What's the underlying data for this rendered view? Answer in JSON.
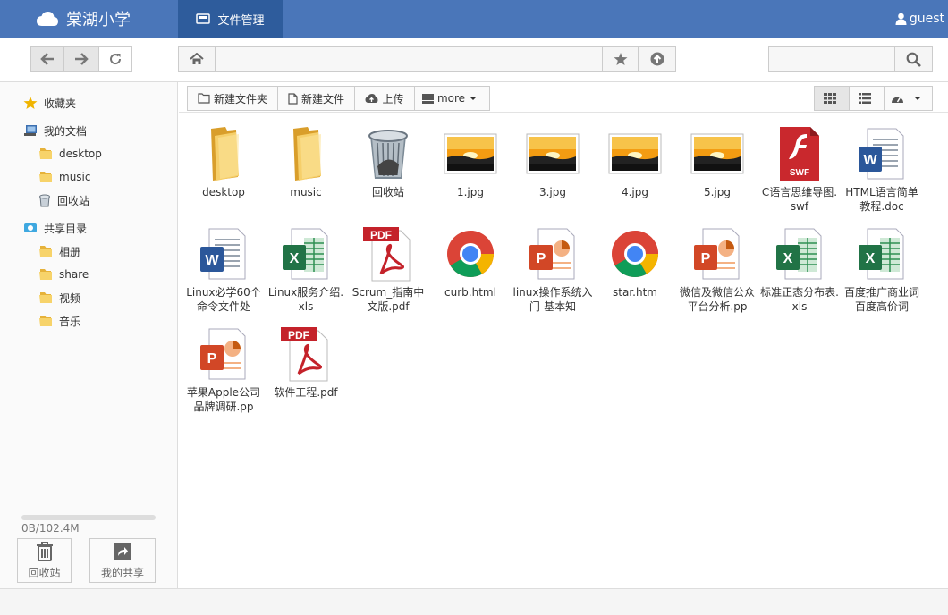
{
  "app": {
    "title": "棠湖小学",
    "active_tab": "文件管理",
    "user": "guest"
  },
  "toolbar": {
    "address": "",
    "search_placeholder": ""
  },
  "sidebar": {
    "items": [
      {
        "label": "收藏夹",
        "icon": "star-icon",
        "level": 0
      },
      {
        "label": "我的文档",
        "icon": "computer-icon",
        "level": 0
      },
      {
        "label": "desktop",
        "icon": "folder-icon",
        "level": 1
      },
      {
        "label": "music",
        "icon": "folder-icon",
        "level": 1
      },
      {
        "label": "回收站",
        "icon": "recycle-bin-icon",
        "level": 1
      },
      {
        "label": "共享目录",
        "icon": "shared-drive-icon",
        "level": 0
      },
      {
        "label": "相册",
        "icon": "folder-icon",
        "level": 1
      },
      {
        "label": "share",
        "icon": "folder-icon",
        "level": 1
      },
      {
        "label": "视频",
        "icon": "folder-icon",
        "level": 1
      },
      {
        "label": "音乐",
        "icon": "folder-icon",
        "level": 1
      }
    ],
    "quota_text": "0B/102.4M",
    "quota_fraction": 0,
    "buttons": [
      {
        "label": "回收站",
        "icon": "trash-icon"
      },
      {
        "label": "我的共享",
        "icon": "share-icon"
      }
    ]
  },
  "actions": {
    "new_folder": "新建文件夹",
    "new_file": "新建文件",
    "upload": "上传",
    "more": "more"
  },
  "files": [
    {
      "name": "desktop",
      "type": "folder"
    },
    {
      "name": "music",
      "type": "folder"
    },
    {
      "name": "回收站",
      "type": "trash"
    },
    {
      "name": "1.jpg",
      "type": "image"
    },
    {
      "name": "3.jpg",
      "type": "image"
    },
    {
      "name": "4.jpg",
      "type": "image"
    },
    {
      "name": "5.jpg",
      "type": "image"
    },
    {
      "name": "C语言思维导图.swf",
      "type": "swf"
    },
    {
      "name": "HTML语言简单教程.doc",
      "type": "doc"
    },
    {
      "name": "Linux必学60个命令文件处",
      "type": "doc"
    },
    {
      "name": "Linux服务介绍.xls",
      "type": "xls"
    },
    {
      "name": "Scrum_指南中文版.pdf",
      "type": "pdf"
    },
    {
      "name": "curb.html",
      "type": "chrome"
    },
    {
      "name": "linux操作系统入门-基本知",
      "type": "ppt"
    },
    {
      "name": "star.htm",
      "type": "chrome"
    },
    {
      "name": "微信及微信公众平台分析.pp",
      "type": "ppt"
    },
    {
      "name": "标准正态分布表.xls",
      "type": "xls"
    },
    {
      "name": "百度推广商业词 百度高价词",
      "type": "xls"
    },
    {
      "name": "苹果Apple公司品牌调研.pp",
      "type": "ppt"
    },
    {
      "name": "软件工程.pdf",
      "type": "pdf"
    }
  ],
  "colors": {
    "header": "#4a76b9",
    "header_active": "#2e5c9c"
  }
}
